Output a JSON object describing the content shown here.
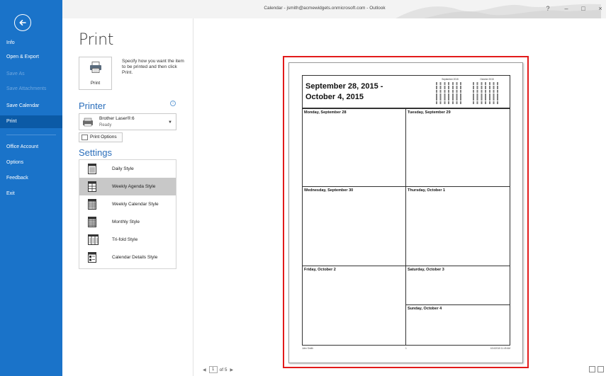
{
  "window": {
    "title": "Calendar - jsmith@acmewidgets.onmicrosoft.com - Outlook",
    "help_label": "?",
    "minimize_label": "–",
    "maximize_label": "□",
    "close_label": "×"
  },
  "sidebar": {
    "items": [
      {
        "label": "Info",
        "state": "normal"
      },
      {
        "label": "Open & Export",
        "state": "normal"
      },
      {
        "label": "Save As",
        "state": "disabled"
      },
      {
        "label": "Save Attachments",
        "state": "disabled"
      },
      {
        "label": "Save Calendar",
        "state": "normal"
      },
      {
        "label": "Print",
        "state": "active"
      },
      {
        "label": "Office Account",
        "state": "normal"
      },
      {
        "label": "Options",
        "state": "normal"
      },
      {
        "label": "Feedback",
        "state": "normal"
      },
      {
        "label": "Exit",
        "state": "normal"
      }
    ],
    "colors": {
      "background": "#1a73c9",
      "active": "#0b5aa6"
    }
  },
  "print": {
    "title": "Print",
    "button_label": "Print",
    "description": "Specify how you want the item to be printed and then click Print."
  },
  "printer": {
    "heading": "Printer",
    "name": "Brother Laser®:6",
    "status": "Ready",
    "options_label": "Print Options"
  },
  "settings": {
    "heading": "Settings",
    "styles": [
      {
        "label": "Daily Style",
        "icon": "daily-style-icon"
      },
      {
        "label": "Weekly Agenda Style",
        "icon": "weekly-agenda-style-icon",
        "selected": true
      },
      {
        "label": "Weekly Calendar Style",
        "icon": "weekly-calendar-style-icon"
      },
      {
        "label": "Monthly Style",
        "icon": "monthly-style-icon"
      },
      {
        "label": "Tri-fold Style",
        "icon": "tri-fold-style-icon"
      },
      {
        "label": "Calendar Details Style",
        "icon": "calendar-details-style-icon"
      }
    ]
  },
  "preview": {
    "range_line1": "September 28, 2015 -",
    "range_line2": "October 4, 2015",
    "mini_cal_1": "September 2015",
    "mini_cal_2": "October 2015",
    "days": [
      "Monday, September 28",
      "Tuesday, September 29",
      "Wednesday, September 30",
      "Thursday, October 1",
      "Friday, October 2",
      "Saturday, October 3",
      "Sunday, October 4"
    ],
    "footer_left": "John Smith",
    "footer_mid": "1",
    "footer_right": "10/4/2015 11:49 AM",
    "highlight_color": "#e21a1a"
  },
  "pagination": {
    "prev": "◀",
    "current": "1",
    "total_label": "of 5",
    "next": "▶"
  }
}
